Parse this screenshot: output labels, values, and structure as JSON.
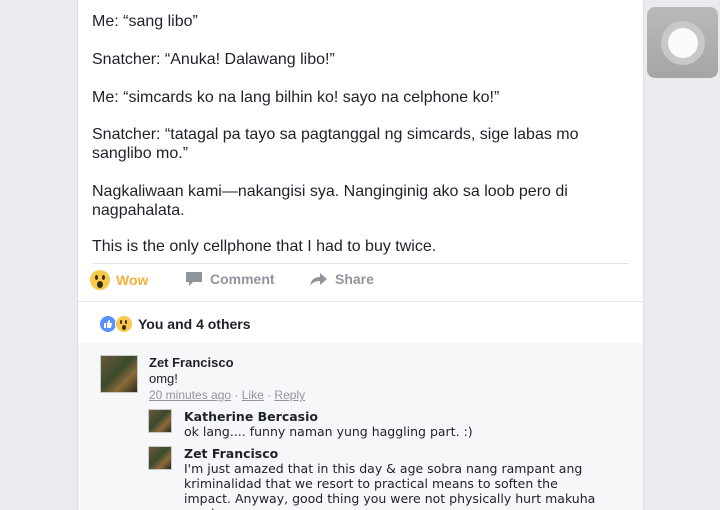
{
  "post": {
    "lines": [
      "Me: “sang libo”",
      "Snatcher: “Anuka! Dalawang libo!”",
      "Me: “simcards ko na lang bilhin ko! sayo na celphone ko!”",
      "Snatcher: “tatagal pa tayo sa pagtanggal ng simcards, sige labas mo sanglibo mo.”",
      "Nagkaliwaan kami—nakangisi sya. Nanginginig ako sa loob pero di nagpahalata.",
      "This is the only cellphone that I had to buy twice."
    ]
  },
  "actions": {
    "wow_label": "Wow",
    "comment_label": "Comment",
    "share_label": "Share"
  },
  "reactions": {
    "summary": "You and 4 others"
  },
  "comments": [
    {
      "name": "Zet Francisco",
      "text": "omg!",
      "time": "20 minutes ago",
      "sep1": " · ",
      "like": "Like",
      "sep2": " · ",
      "reply": "Reply"
    }
  ],
  "replies": [
    {
      "name": "Katherine Bercasio",
      "text": "ok lang.... funny naman yung haggling part. :)"
    },
    {
      "name": "Zet Francisco",
      "text": "I'm just amazed that in this day & age sobra nang rampant ang kriminalidad that we resort to practical means to soften the impact. Anyway, good thing you were not physically hurt makuha nya lang"
    }
  ],
  "colors": {
    "wow_accent": "#f2b13a",
    "link_gray": "#90949c",
    "like_blue": "#5890ff"
  }
}
